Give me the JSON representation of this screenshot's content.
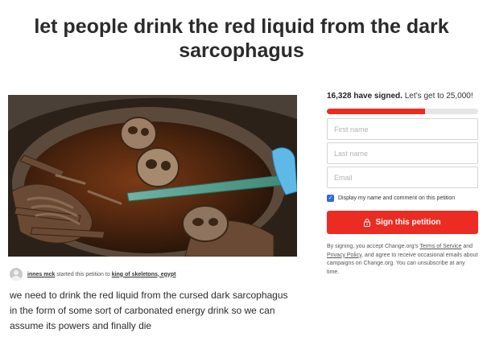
{
  "page": {
    "title": "let people drink the red liquid from the dark sarcophagus"
  },
  "hero_image": {
    "icon": "sarcophagus-photo"
  },
  "starter": {
    "name": "innes mck",
    "action": " started this petition to ",
    "target": "king of skeletons, egypt"
  },
  "description": "we need to drink the red liquid from the cursed dark sarcophagus in the form of some sort of carbonated energy drink so we can assume its powers and finally die",
  "signatures": {
    "signed": "16,328 have signed.",
    "goal": " Let’s get to 25,000!",
    "progress_fraction": 0.65,
    "progress_color": "#ec2c22"
  },
  "form": {
    "first_name_placeholder": "First name",
    "last_name_placeholder": "Last name",
    "email_placeholder": "Email",
    "consent_label": "Display my name and comment on this petition",
    "consent_checked": true,
    "sign_button_label": "Sign this petition",
    "sign_button_color": "#ec2c22",
    "lock_icon": "lock-icon"
  },
  "legal": {
    "prefix": "By signing, you accept Change.org’s ",
    "terms_link": "Terms of Service",
    "and": " and ",
    "privacy_link": "Privacy Policy",
    "suffix": ", and agree to receive occasional emails about campaigns on Change.org. You can unsubscribe at any time."
  }
}
